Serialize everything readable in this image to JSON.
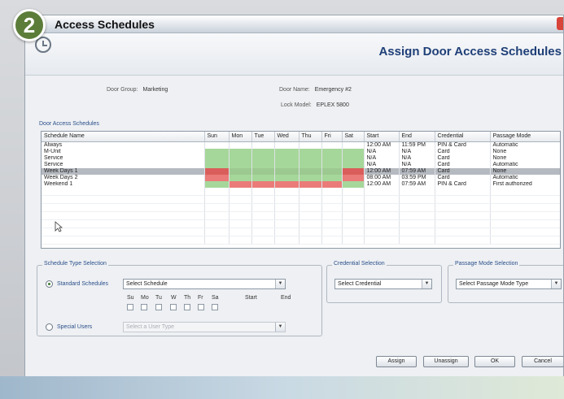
{
  "step_badge": "2",
  "window": {
    "title": "Access Schedules"
  },
  "header": {
    "title": "Assign Door Access Schedules"
  },
  "info": {
    "door_group_label": "Door Group:",
    "door_group_value": "Marketing",
    "door_name_label": "Door Name:",
    "door_name_value": "Emergency #2",
    "lock_model_label": "Lock Model:",
    "lock_model_value": "EPLEX 5800"
  },
  "schedules_section_label": "Door Access Schedules",
  "table": {
    "columns": [
      "Schedule Name",
      "Sun",
      "Mon",
      "Tue",
      "Wed",
      "Thu",
      "Fri",
      "Sat",
      "Start",
      "End",
      "Credential",
      "Passage Mode"
    ],
    "rows": [
      {
        "name": "Always",
        "days": [
          "",
          "",
          "",
          "",
          "",
          "",
          ""
        ],
        "start": "12:00 AM",
        "end": "11:59 PM",
        "credential": "PIN & Card",
        "mode": "Automatic"
      },
      {
        "name": "M-Unit",
        "days": [
          "g",
          "g",
          "g",
          "g",
          "g",
          "g",
          "g"
        ],
        "start": "N/A",
        "end": "N/A",
        "credential": "Card",
        "mode": "None"
      },
      {
        "name": "Service",
        "days": [
          "g",
          "g",
          "g",
          "g",
          "g",
          "g",
          "g"
        ],
        "start": "N/A",
        "end": "N/A",
        "credential": "Card",
        "mode": "None"
      },
      {
        "name": "Service",
        "days": [
          "g",
          "g",
          "g",
          "g",
          "g",
          "g",
          "g"
        ],
        "start": "N/A",
        "end": "N/A",
        "credential": "Card",
        "mode": "Automatic"
      },
      {
        "name": "Week Days 1",
        "days": [
          "r",
          "g",
          "g",
          "g",
          "g",
          "g",
          "r"
        ],
        "start": "12:00 AM",
        "end": "07:59 AM",
        "credential": "Card",
        "mode": "None",
        "selected": true
      },
      {
        "name": "Week Days 2",
        "days": [
          "r",
          "g",
          "g",
          "g",
          "g",
          "g",
          "r"
        ],
        "start": "08:00 AM",
        "end": "03:59 PM",
        "credential": "Card",
        "mode": "Automatic"
      },
      {
        "name": "Weekend 1",
        "days": [
          "g",
          "r",
          "r",
          "r",
          "r",
          "r",
          "g"
        ],
        "start": "12:00 AM",
        "end": "07:59 AM",
        "credential": "PIN & Card",
        "mode": "First authorized"
      }
    ],
    "empty_rows": 7
  },
  "schedule_type": {
    "title": "Schedule Type Selection",
    "standard_label": "Standard Schedules",
    "standard_select": "Select Schedule",
    "days": [
      "Su",
      "Mo",
      "Tu",
      "W",
      "Th",
      "Fr",
      "Sa"
    ],
    "start_label": "Start",
    "end_label": "End",
    "special_label": "Special Users",
    "special_select": "Select a User Type"
  },
  "credential": {
    "title": "Credential Selection",
    "select": "Select Credential"
  },
  "passage_mode": {
    "title": "Passage Mode Selection",
    "select": "Select Passage Mode Type"
  },
  "buttons": {
    "assign": "Assign",
    "unassign": "Unassign",
    "ok": "OK",
    "cancel": "Cancel"
  },
  "colors": {
    "allowed": "#a6d79a",
    "denied": "#ea7b78",
    "header_title": "#1f3f78",
    "badge": "#5c7d3a"
  }
}
